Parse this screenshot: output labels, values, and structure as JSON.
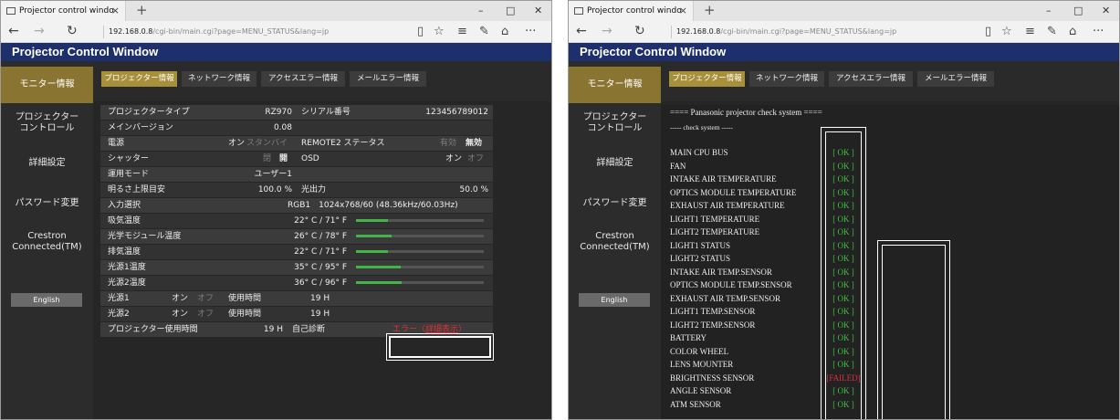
{
  "browser": {
    "tab_title": "Projector control windo",
    "tab_close": "×",
    "new_tab": "+",
    "url_host": "192.168.0.8",
    "url_path": "/cgi-bin/main.cgi?page=MENU_STATUS&lang=jp",
    "min": "–",
    "max": "□",
    "close": "✕",
    "back": "←",
    "forward": "→",
    "refresh": "↻",
    "reading": "▯",
    "star": "☆",
    "hub": "≡",
    "note": "✎",
    "share": "⌂",
    "more": "···"
  },
  "app_title": "Projector Control Window",
  "sidebar": [
    {
      "label": "モニター情報"
    },
    {
      "label": "プロジェクター\nコントロール"
    },
    {
      "label": "詳細設定"
    },
    {
      "label": "パスワード変更"
    },
    {
      "label": "Crestron\nConnected(TM)"
    }
  ],
  "english_button": "English",
  "tabs": [
    {
      "label": "プロジェクター情報"
    },
    {
      "label": "ネットワーク情報"
    },
    {
      "label": "アクセスエラー情報"
    },
    {
      "label": "メールエラー情報"
    }
  ],
  "status": {
    "type_label": "プロジェクタータイプ",
    "type_value": "RZ970",
    "serial_label": "シリアル番号",
    "serial_value": "123456789012",
    "version_label": "メインバージョン",
    "version_value": "0.08",
    "power_label": "電源",
    "power_on": "オン",
    "power_standby": "スタンバイ",
    "remote2_label": "REMOTE2 ステータス",
    "remote2_enabled": "有効",
    "remote2_disabled": "無効",
    "shutter_label": "シャッター",
    "shutter_closed": "閉",
    "shutter_open": "開",
    "osd_label": "OSD",
    "osd_on": "オン",
    "osd_off": "オフ",
    "mode_label": "運用モード",
    "mode_value": "ユーザー1",
    "bright_label": "明るさ上限目安",
    "bright_value": "100.0 %",
    "output_label": "光出力",
    "output_value": "50.0 %",
    "input_label": "入力選択",
    "input_value": "RGB1　1024x768/60 (48.36kHz/60.03Hz)",
    "temps": [
      {
        "label": "吸気温度",
        "value": "22° C / 71° F",
        "level": 0.25
      },
      {
        "label": "光学モジュール温度",
        "value": "26° C / 78° F",
        "level": 0.28
      },
      {
        "label": "排気温度",
        "value": "22° C / 71° F",
        "level": 0.25
      },
      {
        "label": "光源1温度",
        "value": "35° C / 95° F",
        "level": 0.35
      },
      {
        "label": "光源2温度",
        "value": "36° C / 96° F",
        "level": 0.36
      }
    ],
    "light1_label": "光源1",
    "light2_label": "光源2",
    "on": "オン",
    "off": "オフ",
    "usage_label": "使用時間",
    "light1_hours": "19 H",
    "light2_hours": "19 H",
    "proj_hours_label": "プロジェクター使用時間",
    "proj_hours_value": "19 H",
    "selfdiag_label": "自己診断",
    "error_prefix": "エラー（",
    "error_link": "詳細表示",
    "error_suffix": "）"
  },
  "check": {
    "header": "==== Panasonic projector check system ====",
    "sub": "----- check system -----",
    "items": [
      {
        "name": "MAIN CPU BUS",
        "status": "[ OK ]"
      },
      {
        "name": "FAN",
        "status": "[ OK ]"
      },
      {
        "name": "INTAKE AIR TEMPERATURE",
        "status": "[ OK ]"
      },
      {
        "name": "OPTICS MODULE TEMPERATURE",
        "status": "[ OK ]"
      },
      {
        "name": "EXHAUST AIR TEMPERATURE",
        "status": "[ OK ]"
      },
      {
        "name": "LIGHT1 TEMPERATURE",
        "status": "[ OK ]"
      },
      {
        "name": "LIGHT2 TEMPERATURE",
        "status": "[ OK ]"
      },
      {
        "name": "LIGHT1 STATUS",
        "status": "[ OK ]"
      },
      {
        "name": "LIGHT2 STATUS",
        "status": "[ OK ]"
      },
      {
        "name": "INTAKE AIR TEMP.SENSOR",
        "status": "[ OK ]"
      },
      {
        "name": "OPTICS MODULE TEMP.SENSOR",
        "status": "[ OK ]"
      },
      {
        "name": "EXHAUST AIR TEMP.SENSOR",
        "status": "[ OK ]"
      },
      {
        "name": "LIGHT1 TEMP.SENSOR",
        "status": "[ OK ]"
      },
      {
        "name": "LIGHT2 TEMP.SENSOR",
        "status": "[ OK ]"
      },
      {
        "name": "BATTERY",
        "status": "[ OK ]"
      },
      {
        "name": "COLOR WHEEL",
        "status": "[ OK ]"
      },
      {
        "name": "LENS MOUNTER",
        "status": "[ OK ]"
      },
      {
        "name": "BRIGHTNESS SENSOR",
        "status": "[FAILED]"
      },
      {
        "name": "ANGLE SENSOR",
        "status": "[ OK ]"
      },
      {
        "name": "ATM SENSOR",
        "status": "[ OK ]"
      }
    ]
  },
  "colors": {
    "title_bar": "#1d2f6d",
    "active": "#8a7431",
    "ok": "#3fc43f",
    "fail": "#e0303a",
    "bar": "#44b34a"
  }
}
